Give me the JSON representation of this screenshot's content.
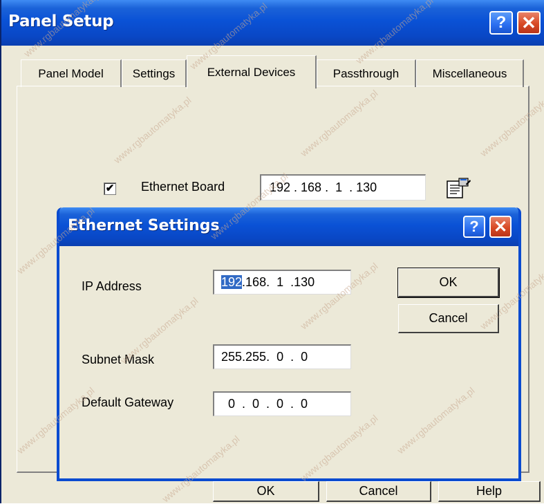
{
  "main_window": {
    "title": "Panel Setup",
    "help_glyph": "?",
    "close_glyph": "✕"
  },
  "tabs": [
    {
      "label": "Panel Model"
    },
    {
      "label": "Settings"
    },
    {
      "label": "External Devices",
      "active": true
    },
    {
      "label": "Passthrough"
    },
    {
      "label": "Miscellaneous"
    }
  ],
  "ethernet_board": {
    "checkbox_checked": true,
    "checkbox_glyph": "✔",
    "label": "Ethernet Board",
    "ip_value": "192 . 168 .  1  . 130",
    "properties_icon": "properties-icon"
  },
  "ethernet_settings": {
    "title": "Ethernet Settings",
    "help_glyph": "?",
    "close_glyph": "✕",
    "ip_label": "IP Address",
    "ip_selected": "192",
    "ip_rest": ".168.  1  .130",
    "subnet_label": "Subnet Mask",
    "subnet_value": "255.255.  0  .  0",
    "gateway_label": "Default Gateway",
    "gateway_value": "  0  .  0  .  0  .  0",
    "ok_label": "OK",
    "cancel_label": "Cancel"
  },
  "footer_buttons": {
    "ok_label": "OK",
    "cancel_label": "Cancel",
    "help_label": "Help"
  },
  "watermark": "www.rgbautomatyka.pl",
  "colors": {
    "title_blue": "#0a52d6",
    "dialog_face": "#ece9d8",
    "close_red": "#d84a25",
    "selection": "#316ac5"
  }
}
